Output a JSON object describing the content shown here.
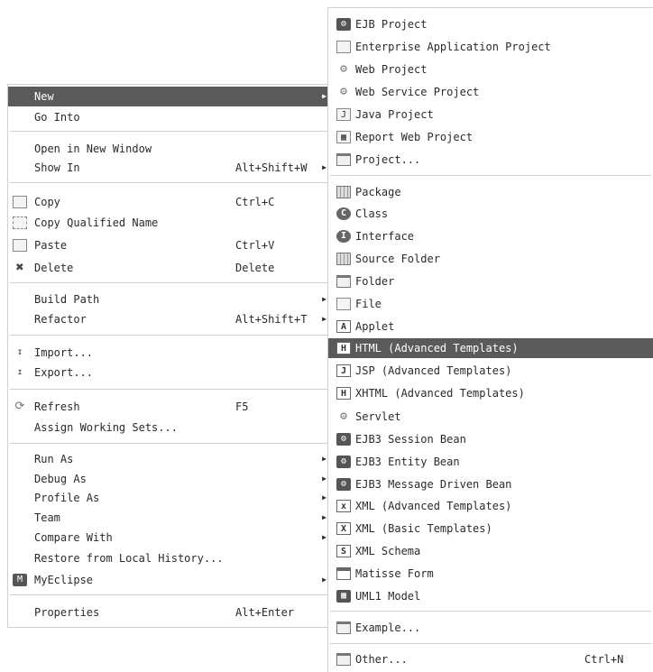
{
  "main_menu": {
    "new": {
      "label": "New"
    },
    "go_into": {
      "label": "Go Into"
    },
    "open_in_new_window": {
      "label": "Open in New Window"
    },
    "show_in": {
      "label": "Show In",
      "accel": "Alt+Shift+W"
    },
    "copy": {
      "label": "Copy",
      "accel": "Ctrl+C"
    },
    "copy_qualified_name": {
      "label": "Copy Qualified Name"
    },
    "paste": {
      "label": "Paste",
      "accel": "Ctrl+V"
    },
    "delete": {
      "label": "Delete",
      "accel": "Delete"
    },
    "build_path": {
      "label": "Build Path"
    },
    "refactor": {
      "label": "Refactor",
      "accel": "Alt+Shift+T"
    },
    "import": {
      "label": "Import..."
    },
    "export": {
      "label": "Export..."
    },
    "refresh": {
      "label": "Refresh",
      "accel": "F5"
    },
    "assign_working_sets": {
      "label": "Assign Working Sets..."
    },
    "run_as": {
      "label": "Run As"
    },
    "debug_as": {
      "label": "Debug As"
    },
    "profile_as": {
      "label": "Profile As"
    },
    "team": {
      "label": "Team"
    },
    "compare_with": {
      "label": "Compare With"
    },
    "restore_from_local_history": {
      "label": "Restore from Local History..."
    },
    "myeclipse": {
      "label": "MyEclipse"
    },
    "properties": {
      "label": "Properties",
      "accel": "Alt+Enter"
    }
  },
  "sub_menu": {
    "ejb_project": {
      "label": "EJB Project"
    },
    "enterprise_application_project": {
      "label": "Enterprise Application Project"
    },
    "web_project": {
      "label": "Web Project"
    },
    "web_service_project": {
      "label": "Web Service Project"
    },
    "java_project": {
      "label": "Java Project"
    },
    "report_web_project": {
      "label": "Report Web Project"
    },
    "project": {
      "label": "Project..."
    },
    "package": {
      "label": "Package"
    },
    "class": {
      "label": "Class"
    },
    "interface": {
      "label": "Interface"
    },
    "source_folder": {
      "label": "Source Folder"
    },
    "folder": {
      "label": "Folder"
    },
    "file": {
      "label": "File"
    },
    "applet": {
      "label": "Applet"
    },
    "html": {
      "label": "HTML (Advanced Templates)"
    },
    "jsp": {
      "label": "JSP (Advanced Templates)"
    },
    "xhtml": {
      "label": "XHTML (Advanced Templates)"
    },
    "servlet": {
      "label": "Servlet"
    },
    "ejb3_session_bean": {
      "label": "EJB3 Session Bean"
    },
    "ejb3_entity_bean": {
      "label": "EJB3 Entity Bean"
    },
    "ejb3_message_driven_bean": {
      "label": "EJB3 Message Driven Bean"
    },
    "xml_advanced": {
      "label": "XML (Advanced Templates)"
    },
    "xml_basic": {
      "label": "XML (Basic Templates)"
    },
    "xml_schema": {
      "label": "XML Schema"
    },
    "matisse_form": {
      "label": "Matisse Form"
    },
    "uml1_model": {
      "label": "UML1 Model"
    },
    "example": {
      "label": "Example..."
    },
    "other": {
      "label": "Other...",
      "accel": "Ctrl+N"
    }
  },
  "icons": {
    "ejb_project": "ejb-project-icon",
    "enterprise_application_project": "ear-project-icon",
    "web_project": "web-project-icon",
    "web_service_project": "web-service-project-icon",
    "java_project": "java-project-icon",
    "report_web_project": "report-project-icon",
    "project": "new-project-icon",
    "package": "package-icon",
    "class": "class-icon",
    "interface": "interface-icon",
    "source_folder": "source-folder-icon",
    "folder": "folder-icon",
    "file": "file-icon",
    "applet": "applet-icon",
    "html": "html-icon",
    "jsp": "jsp-icon",
    "xhtml": "xhtml-icon",
    "servlet": "servlet-icon",
    "ejb3": "ejb3-bean-icon",
    "xml": "xml-icon",
    "xml_schema": "xml-schema-icon",
    "matisse_form": "matisse-form-icon",
    "uml1_model": "uml-model-icon",
    "example": "example-icon",
    "other": "wizard-icon",
    "copy": "copy-icon",
    "paste": "paste-icon",
    "delete": "delete-icon",
    "import": "import-icon",
    "export": "export-icon",
    "refresh": "refresh-icon",
    "myeclipse": "myeclipse-icon",
    "submenu_arrow": "submenu-arrow-icon"
  },
  "colors": {
    "highlight_bg": "#5a5a5a",
    "highlight_fg": "#ffffff",
    "menu_bg": "#ffffff",
    "separator": "#cfcfcf"
  }
}
